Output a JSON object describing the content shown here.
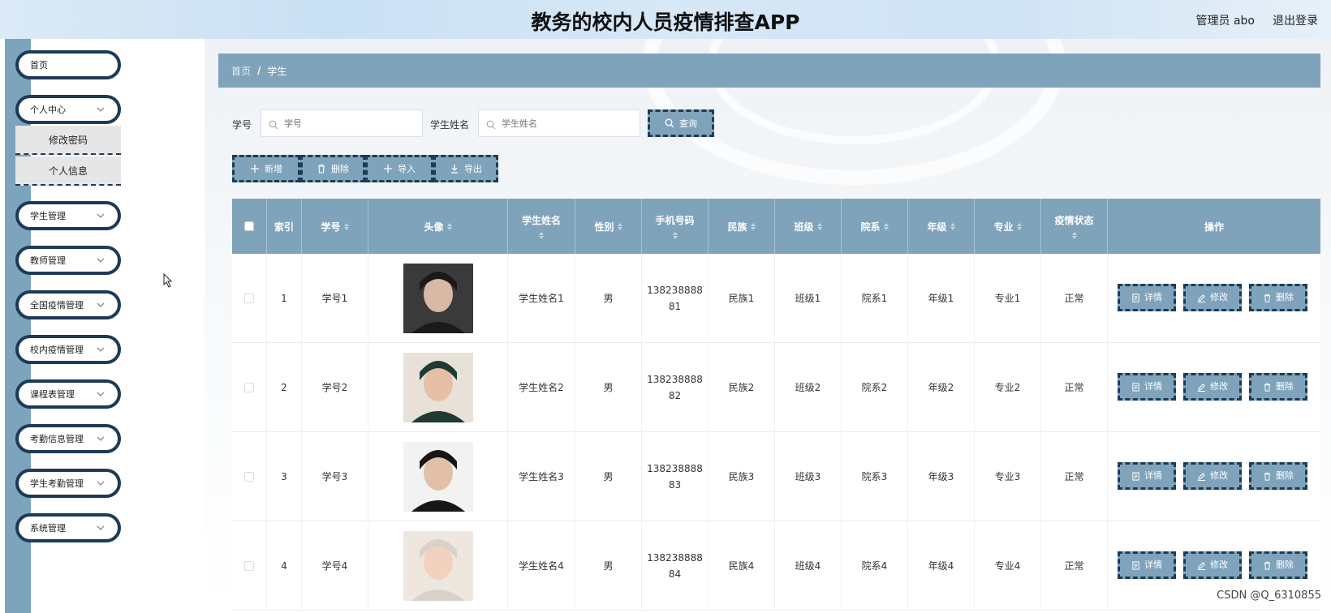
{
  "header": {
    "title": "教务的校内人员疫情排查APP",
    "user": "管理员 abo",
    "logout": "退出登录"
  },
  "sidebar": {
    "items": [
      {
        "label": "首页",
        "chevron": false
      },
      {
        "label": "个人中心",
        "chevron": true
      },
      {
        "label": "学生管理",
        "chevron": true
      },
      {
        "label": "教师管理",
        "chevron": true
      },
      {
        "label": "全国疫情管理",
        "chevron": true
      },
      {
        "label": "校内疫情管理",
        "chevron": true
      },
      {
        "label": "课程表管理",
        "chevron": true
      },
      {
        "label": "考勤信息管理",
        "chevron": true
      },
      {
        "label": "学生考勤管理",
        "chevron": true
      },
      {
        "label": "系统管理",
        "chevron": true
      }
    ],
    "submenu": [
      "修改密码",
      "个人信息"
    ]
  },
  "breadcrumb": {
    "home": "首页",
    "separator": "/",
    "current": "学生"
  },
  "search": {
    "student_id_label": "学号",
    "student_id_placeholder": "学号",
    "student_name_label": "学生姓名",
    "student_name_placeholder": "学生姓名",
    "query_button": "查询"
  },
  "toolbar": {
    "add": "新增",
    "delete": "删除",
    "import": "导入",
    "export": "导出"
  },
  "table": {
    "columns": [
      "索引",
      "学号",
      "头像",
      "学生姓名",
      "性别",
      "手机号码",
      "民族",
      "班级",
      "院系",
      "年级",
      "专业",
      "疫情状态",
      "操作"
    ],
    "rows": [
      {
        "index": "1",
        "student_id": "学号1",
        "name": "学生姓名1",
        "gender": "男",
        "phone_a": "138238888",
        "phone_b": "81",
        "ethnicity": "民族1",
        "class": "班级1",
        "department": "院系1",
        "grade": "年级1",
        "major": "专业1",
        "status": "正常"
      },
      {
        "index": "2",
        "student_id": "学号2",
        "name": "学生姓名2",
        "gender": "男",
        "phone_a": "138238888",
        "phone_b": "82",
        "ethnicity": "民族2",
        "class": "班级2",
        "department": "院系2",
        "grade": "年级2",
        "major": "专业2",
        "status": "正常"
      },
      {
        "index": "3",
        "student_id": "学号3",
        "name": "学生姓名3",
        "gender": "男",
        "phone_a": "138238888",
        "phone_b": "83",
        "ethnicity": "民族3",
        "class": "班级3",
        "department": "院系3",
        "grade": "年级3",
        "major": "专业3",
        "status": "正常"
      },
      {
        "index": "4",
        "student_id": "学号4",
        "name": "学生姓名4",
        "gender": "男",
        "phone_a": "138238888",
        "phone_b": "84",
        "ethnicity": "民族4",
        "class": "班级4",
        "department": "院系4",
        "grade": "年级4",
        "major": "专业4",
        "status": "正常"
      }
    ],
    "actions": {
      "detail": "详情",
      "edit": "修改",
      "delete": "删除"
    }
  },
  "watermark": "CSDN @Q_6310855",
  "colors": {
    "accent": "#7fa3bb",
    "border_dark": "#1d3a56",
    "strip": "#7da4bd"
  }
}
